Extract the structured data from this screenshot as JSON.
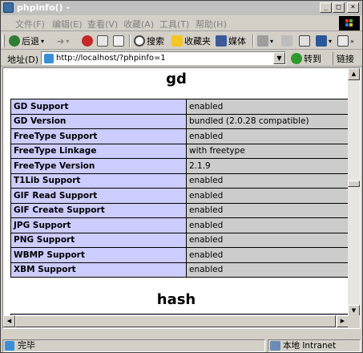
{
  "window": {
    "title": "phpinfo() -"
  },
  "menu": {
    "items": [
      "文件(F)",
      "编辑(E)",
      "查看(V)",
      "收藏(A)",
      "工具(T)",
      "帮助(H)"
    ]
  },
  "toolbar": {
    "back_label": "后退",
    "search_label": "搜索",
    "favorites_label": "收藏夹",
    "media_label": "媒体"
  },
  "address": {
    "label": "地址(D)",
    "url": "http://localhost/?phpinfo=1",
    "go_label": "转到",
    "links_label": "链接"
  },
  "page": {
    "gd_heading": "gd",
    "gd_rows": [
      {
        "key": "GD Support",
        "value": "enabled"
      },
      {
        "key": "GD Version",
        "value": "bundled (2.0.28 compatible)"
      },
      {
        "key": "FreeType Support",
        "value": "enabled"
      },
      {
        "key": "FreeType Linkage",
        "value": "with freetype"
      },
      {
        "key": "FreeType Version",
        "value": "2.1.9"
      },
      {
        "key": "T1Lib Support",
        "value": "enabled"
      },
      {
        "key": "GIF Read Support",
        "value": "enabled"
      },
      {
        "key": "GIF Create Support",
        "value": "enabled"
      },
      {
        "key": "JPG Support",
        "value": "enabled"
      },
      {
        "key": "PNG Support",
        "value": "enabled"
      },
      {
        "key": "WBMP Support",
        "value": "enabled"
      },
      {
        "key": "XBM Support",
        "value": "enabled"
      }
    ],
    "hash_heading": "hash"
  },
  "status": {
    "text": "完毕",
    "zone": "本地 Intranet"
  },
  "colors": {
    "key_cell": "#ccccff",
    "value_cell": "#cccccc",
    "chrome": "#d4d0c8"
  }
}
